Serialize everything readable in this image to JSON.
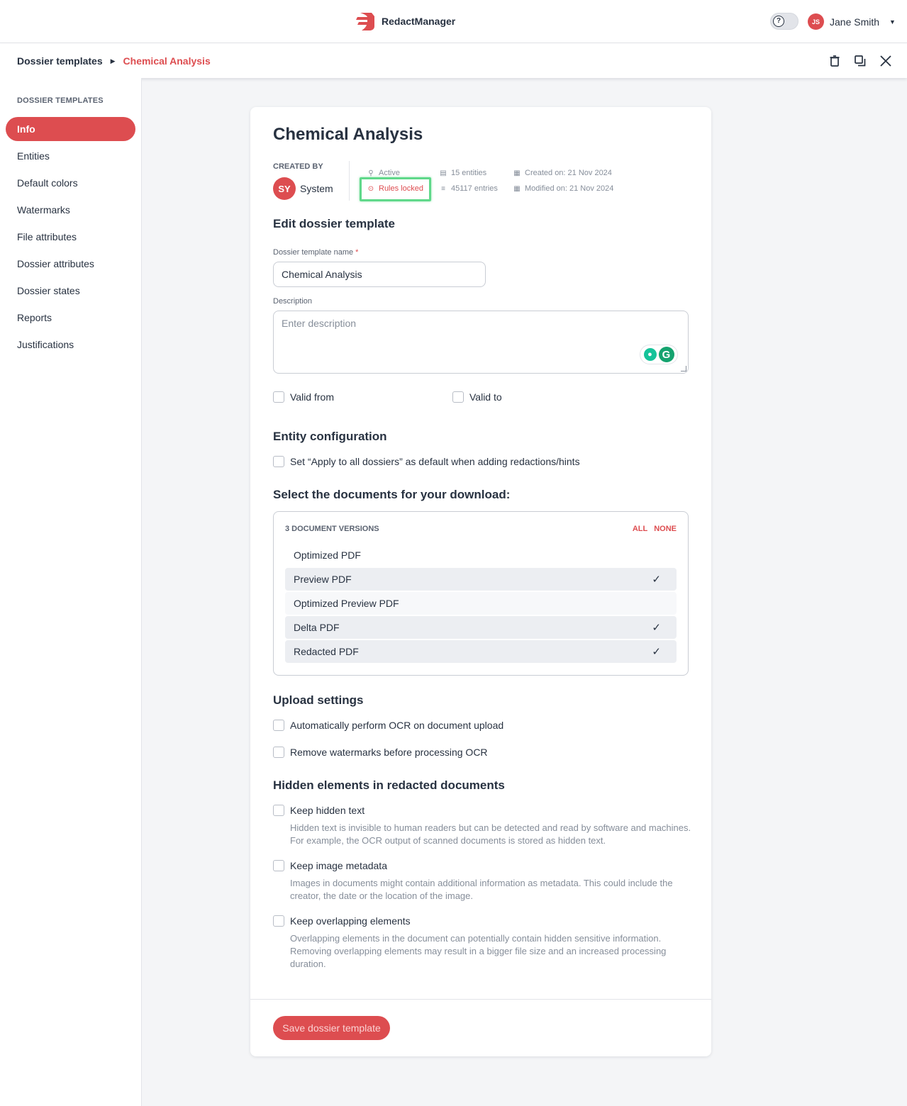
{
  "app": {
    "name": "RedactManager"
  },
  "user": {
    "initials": "JS",
    "name": "Jane Smith",
    "help_icon": "?"
  },
  "breadcrumb": {
    "parent": "Dossier templates",
    "current": "Chemical Analysis"
  },
  "sidebar": {
    "heading": "DOSSIER TEMPLATES",
    "items": [
      {
        "label": "Info",
        "active": true
      },
      {
        "label": "Entities"
      },
      {
        "label": "Default colors"
      },
      {
        "label": "Watermarks"
      },
      {
        "label": "File attributes"
      },
      {
        "label": "Dossier attributes"
      },
      {
        "label": "Dossier states"
      },
      {
        "label": "Reports"
      },
      {
        "label": "Justifications"
      }
    ]
  },
  "template": {
    "title": "Chemical Analysis",
    "created_by_label": "CREATED BY",
    "creator_initials": "SY",
    "creator_name": "System",
    "status": "Active",
    "rules": "Rules locked",
    "entities": "15 entities",
    "entries": "45117 entries",
    "created_on": "Created on: 21 Nov 2024",
    "modified_on": "Modified on: 21 Nov 2024"
  },
  "form": {
    "section_title": "Edit dossier template",
    "name_label": "Dossier template name",
    "required_mark": "*",
    "name_value": "Chemical Analysis",
    "description_label": "Description",
    "description_placeholder": "Enter description",
    "valid_from": "Valid from",
    "valid_to": "Valid to"
  },
  "entity_config": {
    "title": "Entity configuration",
    "apply_all": "Set “Apply to all dossiers” as default when adding redactions/hints"
  },
  "download": {
    "title": "Select the documents for your download:",
    "count_label": "3 DOCUMENT VERSIONS",
    "all": "ALL",
    "none": "NONE",
    "options": [
      {
        "label": "Optimized PDF",
        "selected": false
      },
      {
        "label": "Preview PDF",
        "selected": true
      },
      {
        "label": "Optimized Preview PDF",
        "selected": false
      },
      {
        "label": "Delta PDF",
        "selected": true
      },
      {
        "label": "Redacted PDF",
        "selected": true
      }
    ],
    "check_glyph": "✓"
  },
  "upload": {
    "title": "Upload settings",
    "ocr": "Automatically perform OCR on document upload",
    "watermarks": "Remove watermarks before processing OCR"
  },
  "hidden": {
    "title": "Hidden elements in redacted documents",
    "keep_text": "Keep hidden text",
    "keep_text_desc": "Hidden text is invisible to human readers but can be detected and read by software and machines. For example, the OCR output of scanned documents is stored as hidden text.",
    "keep_meta": "Keep image metadata",
    "keep_meta_desc": "Images in documents might contain additional information as metadata. This could include the creator, the date or the location of the image.",
    "keep_overlap": "Keep overlapping elements",
    "keep_overlap_desc": "Overlapping elements in the document can potentially contain hidden sensitive information. Removing overlapping elements may result in a bigger file size and an increased processing duration."
  },
  "save_label": "Save dossier template",
  "colors": {
    "accent": "#dd4d50",
    "highlight": "#5fd88a",
    "text": "#283241",
    "muted": "#868e9a"
  }
}
